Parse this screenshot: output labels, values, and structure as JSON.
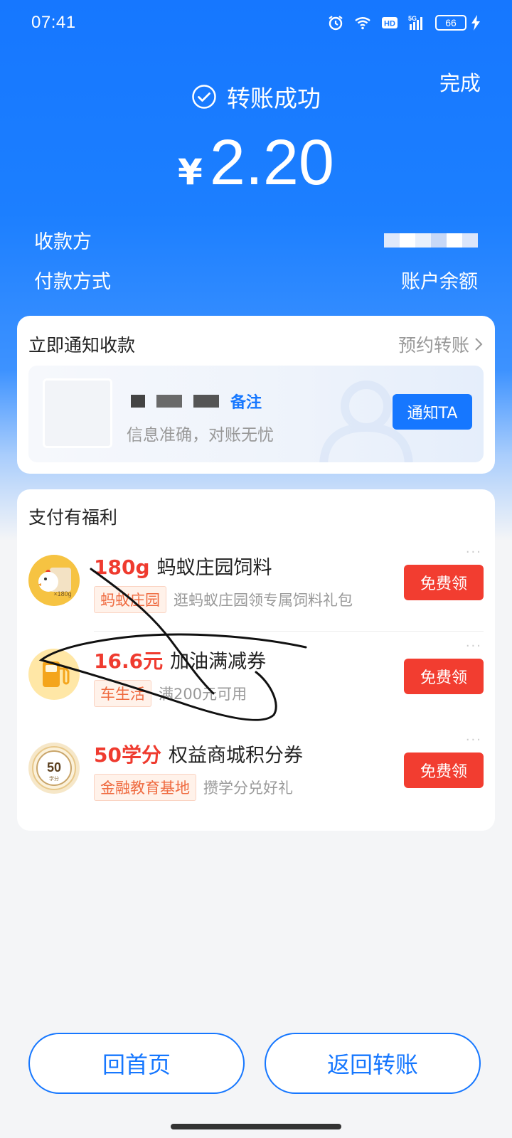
{
  "status_bar": {
    "time": "07:41",
    "network": "5G",
    "hd": "HD",
    "battery": "66",
    "icons": [
      "alarm-icon",
      "wifi-icon",
      "hd-icon",
      "signal-5g-icon",
      "battery-icon",
      "charging-icon"
    ]
  },
  "header": {
    "done_label": "完成",
    "success_title": "转账成功",
    "currency": "¥",
    "amount": "2.20",
    "payee_label": "收款方",
    "pay_method_label": "付款方式",
    "pay_method_value": "账户余额"
  },
  "notify": {
    "title": "立即通知收款",
    "schedule_link": "预约转账",
    "remark_label": "备注",
    "subtitle": "信息准确，对账无忧",
    "button": "通知TA"
  },
  "benefits": {
    "title": "支付有福利",
    "items": [
      {
        "highlight": "180g",
        "name": "蚂蚁庄园饲料",
        "tag": "蚂蚁庄园",
        "desc": "逛蚂蚁庄园领专属饲料礼包",
        "button": "免费领",
        "icon": "chicken-feed-icon",
        "icon_caption": "×180g"
      },
      {
        "highlight": "16.6元",
        "name": "加油满减券",
        "tag": "车生活",
        "desc": "满200元可用",
        "button": "免费领",
        "icon": "fuel-pump-icon"
      },
      {
        "highlight": "50学分",
        "name": "权益商城积分券",
        "tag": "金融教育基地",
        "desc": "攒学分兑好礼",
        "button": "免费领",
        "icon": "credit-coin-icon",
        "icon_number": "50",
        "icon_caption": "学分"
      }
    ]
  },
  "footer": {
    "home_button": "回首页",
    "back_button": "返回转账"
  },
  "colors": {
    "primary_blue": "#1677ff",
    "claim_red": "#f23d30",
    "highlight_red": "#ef3b2f",
    "tag_orange": "#ef6a3f"
  }
}
